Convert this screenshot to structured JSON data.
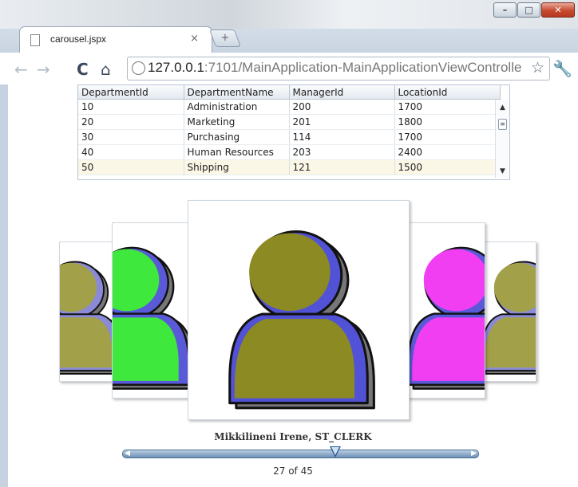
{
  "browser": {
    "tab_title": "carousel.jspx",
    "url_host": "127.0.0.1",
    "url_rest": ":7101/MainApplication-MainApplicationViewControlle"
  },
  "table": {
    "columns": [
      "DepartmentId",
      "DepartmentName",
      "ManagerId",
      "LocationId"
    ],
    "rows": [
      [
        "10",
        "Administration",
        "200",
        "1700"
      ],
      [
        "20",
        "Marketing",
        "201",
        "1800"
      ],
      [
        "30",
        "Purchasing",
        "114",
        "1700"
      ],
      [
        "40",
        "Human Resources",
        "203",
        "2400"
      ],
      [
        "50",
        "Shipping",
        "121",
        "1500"
      ]
    ],
    "selected_row": 4
  },
  "carousel": {
    "caption": "Mikkilineni Irene, ST_CLERK",
    "counter": "27 of 45",
    "position_fraction": 0.6,
    "items": [
      {
        "name": "far-left-person",
        "body": "#a3a04a",
        "shade": "#8a8ad8"
      },
      {
        "name": "left-person",
        "body": "#3ee83c",
        "shade": "#5a5ad8"
      },
      {
        "name": "center-person",
        "body": "#8c8a22",
        "shade": "#5252d6"
      },
      {
        "name": "right-person",
        "body": "#f23ef2",
        "shade": "#5a5ad8"
      },
      {
        "name": "far-right-person",
        "body": "#a3a04a",
        "shade": "#8a8ad8"
      }
    ]
  },
  "colors": {
    "accent": "#4f6f93",
    "selected_row": "#fbf7e6"
  }
}
